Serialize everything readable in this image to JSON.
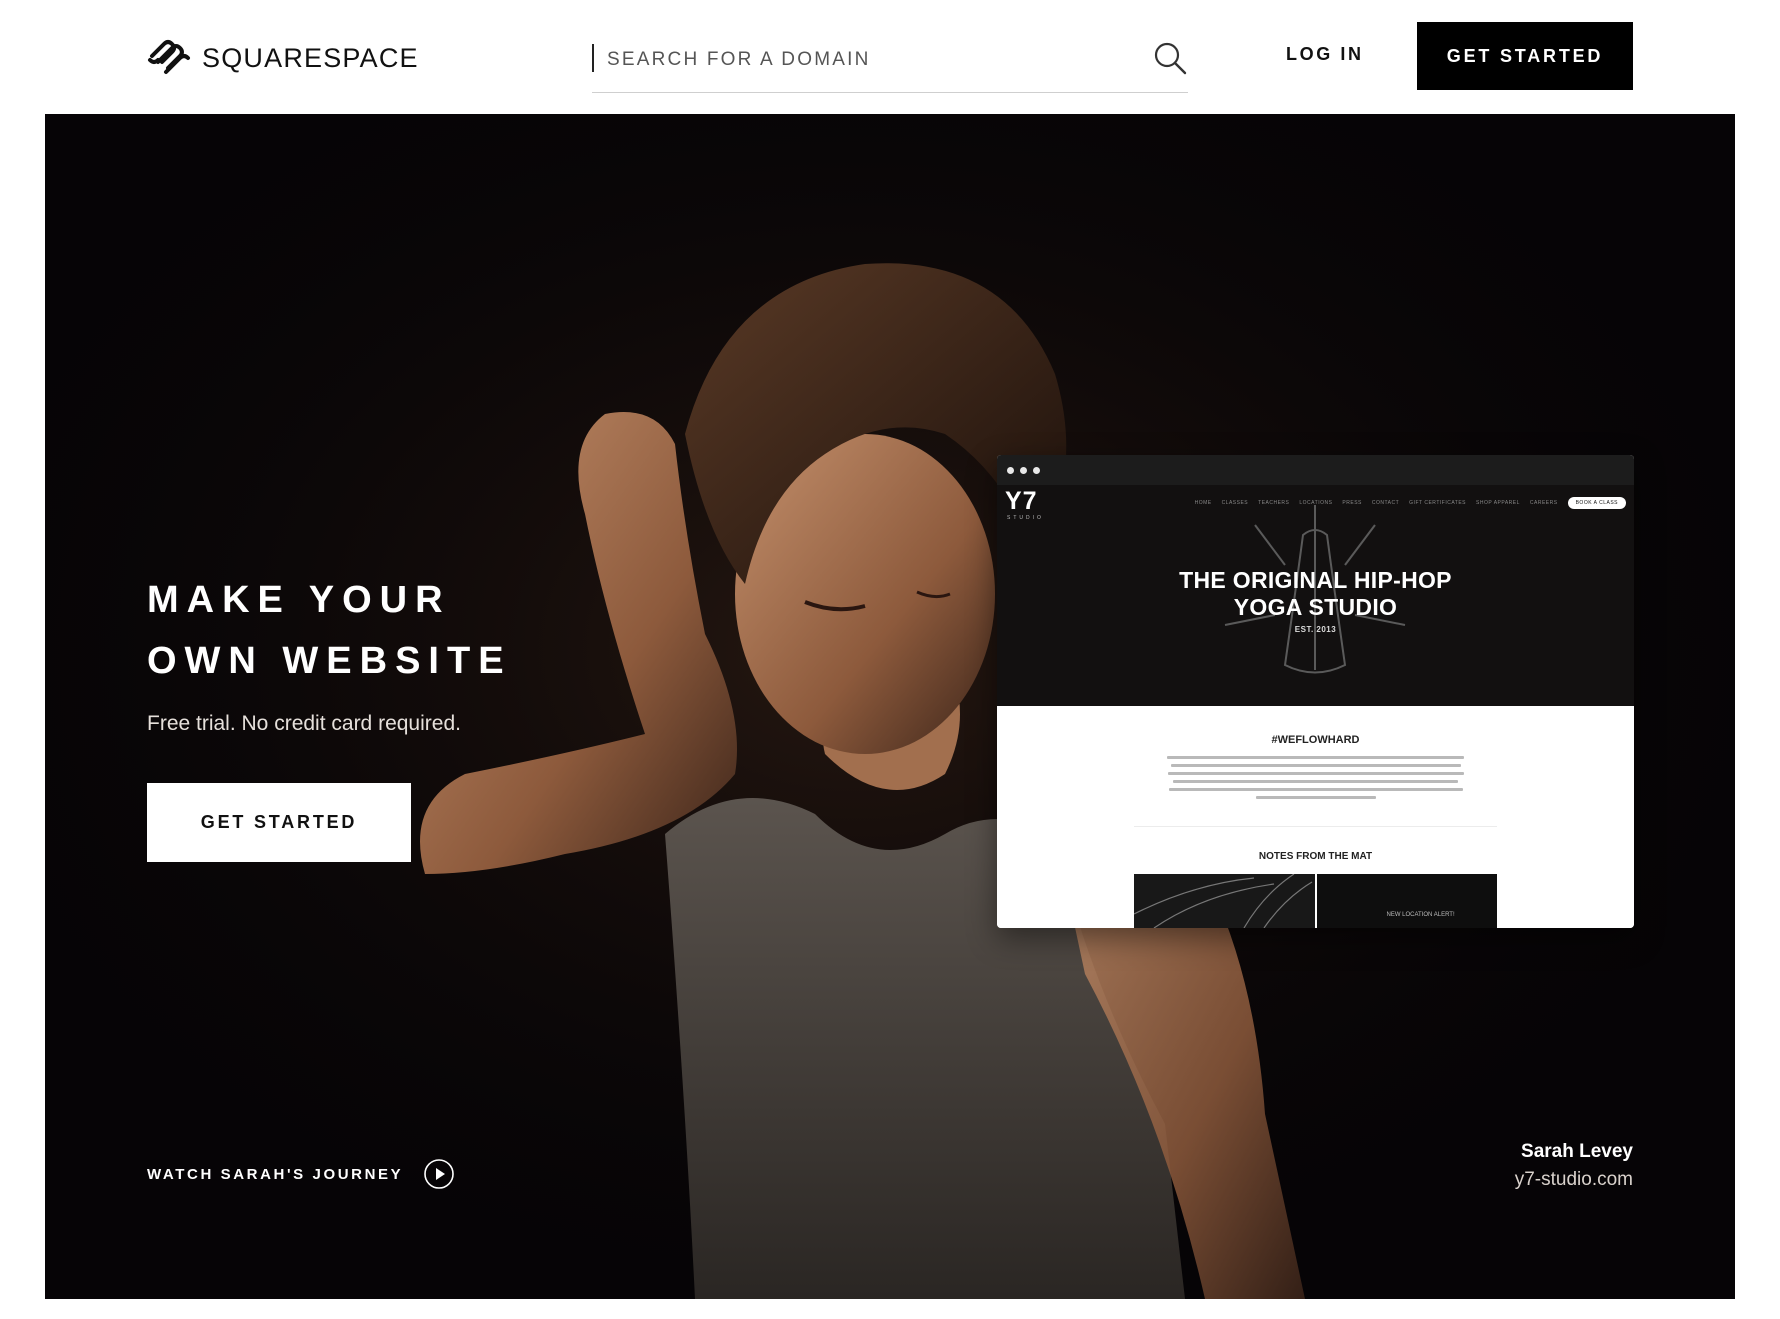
{
  "header": {
    "logo_text": "SQUARESPACE",
    "search_placeholder": "SEARCH FOR A DOMAIN",
    "login_label": "LOG IN",
    "cta_label": "GET STARTED"
  },
  "hero": {
    "title_line1": "MAKE YOUR",
    "title_line2": "OWN WEBSITE",
    "subtitle": "Free trial. No credit card required.",
    "cta_label": "GET STARTED",
    "watch_label": "WATCH SARAH'S JOURNEY",
    "credit_name": "Sarah Levey",
    "credit_url": "y7-studio.com"
  },
  "preview": {
    "logo": "Y7",
    "logo_sub": "STUDIO",
    "nav": [
      "HOME",
      "CLASSES",
      "TEACHERS",
      "LOCATIONS",
      "PRESS",
      "CONTACT",
      "GIFT CERTIFICATES",
      "SHOP APPAREL",
      "CAREERS"
    ],
    "book_label": "BOOK A CLASS",
    "title_line1": "THE ORIGINAL HIP-HOP",
    "title_line2": "YOGA STUDIO",
    "est": "EST. 2013",
    "section1": "#WEFLOWHARD",
    "section2": "NOTES FROM THE MAT",
    "thumb_label": "NEW LOCATION ALERT!"
  },
  "icons": {
    "logo": "squarespace-logo-icon",
    "search": "search-icon",
    "play": "play-icon"
  },
  "colors": {
    "brand_black": "#000000",
    "hero_bg": "#060406"
  }
}
